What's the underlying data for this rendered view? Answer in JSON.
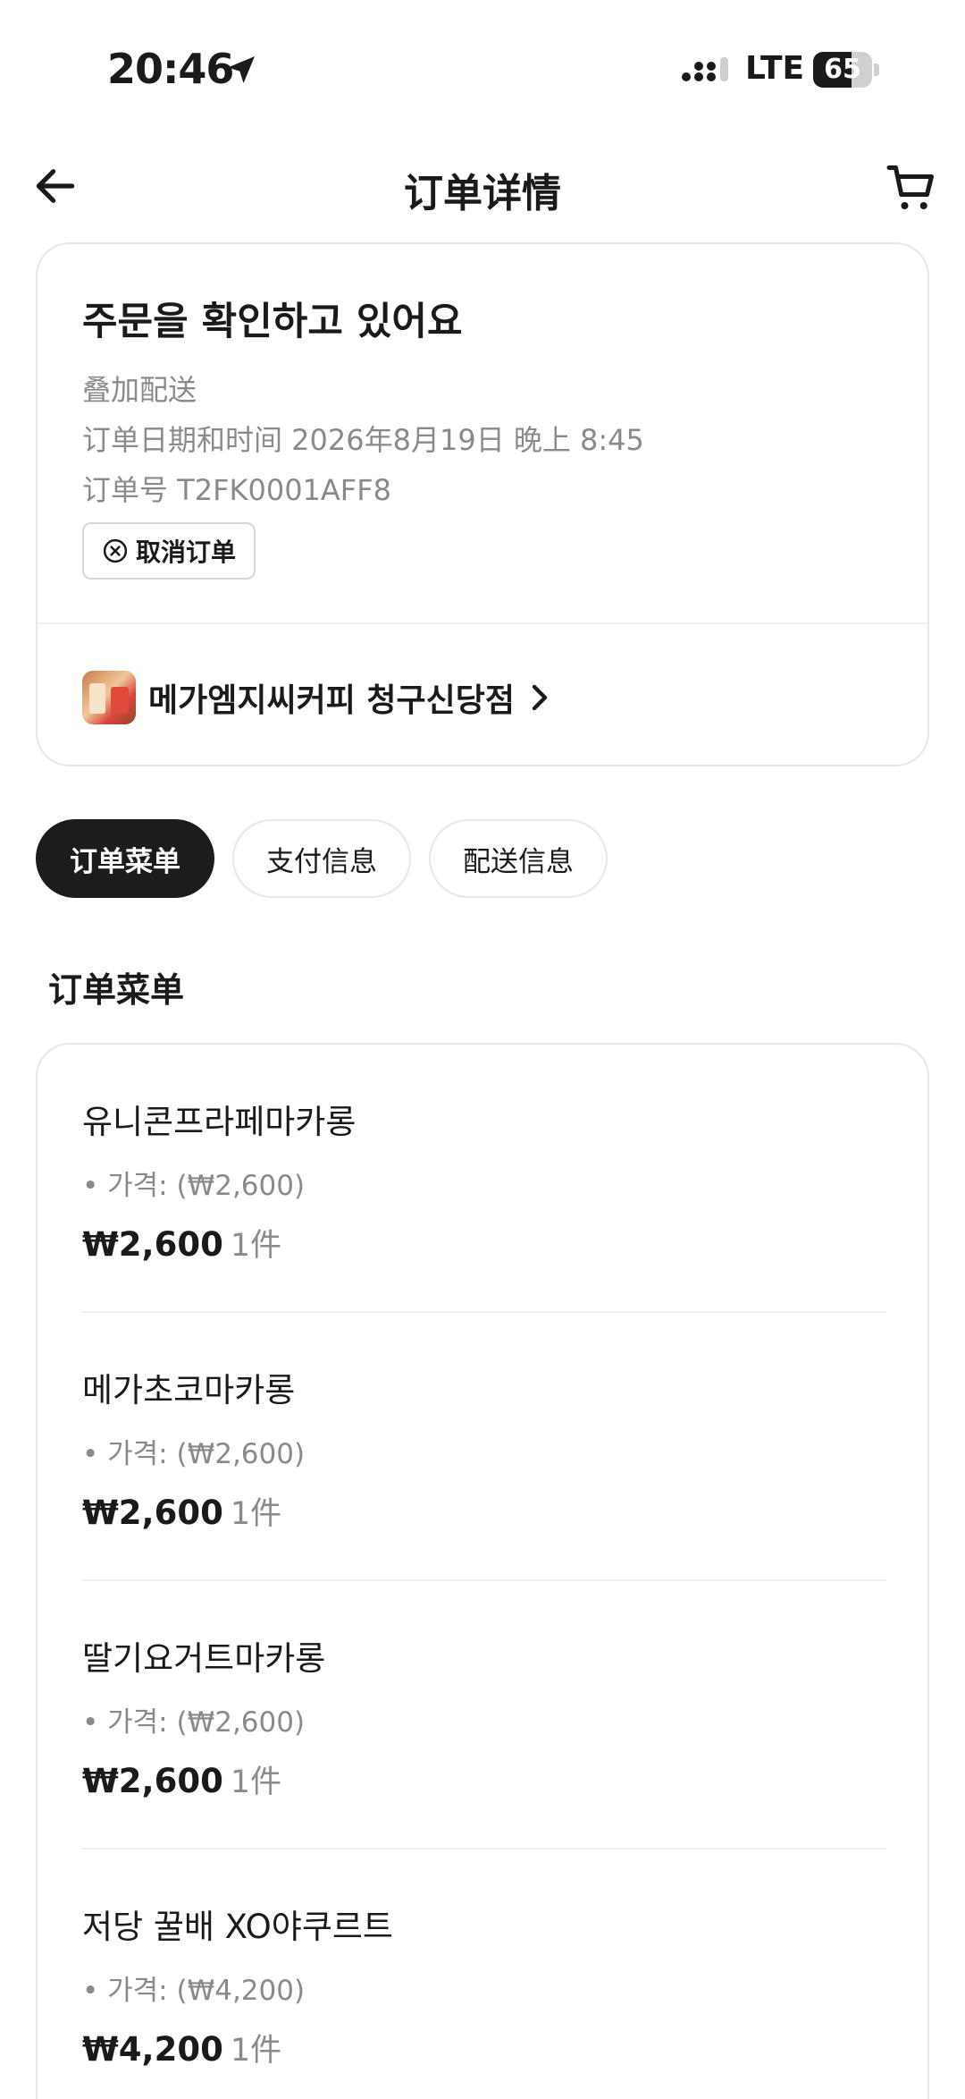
{
  "status_bar": {
    "time": "20:46",
    "network": "LTE",
    "battery": "65",
    "battery_level": 0.65
  },
  "header": {
    "title": "订单详情"
  },
  "order_status": {
    "title": "주문을 확인하고 있어요",
    "delivery_type": "叠加配送",
    "order_datetime": "订单日期和时间 2026年8月19日 晚上 8:45",
    "order_number": "订单号 T2FK0001AFF8",
    "cancel_label": "取消订单",
    "store_name": "메가엠지씨커피 청구신당점"
  },
  "tabs": [
    {
      "label": "订单菜单",
      "active": true
    },
    {
      "label": "支付信息",
      "active": false
    },
    {
      "label": "配送信息",
      "active": false
    }
  ],
  "section_title": "订单菜单",
  "menu_items": [
    {
      "name": "유니콘프라페마카롱",
      "price_option": "• 가격:  (₩2,600)",
      "total": "₩2,600",
      "qty": "1件"
    },
    {
      "name": "메가초코마카롱",
      "price_option": "• 가격:  (₩2,600)",
      "total": "₩2,600",
      "qty": "1件"
    },
    {
      "name": "딸기요거트마카롱",
      "price_option": "• 가격:  (₩2,600)",
      "total": "₩2,600",
      "qty": "1件"
    },
    {
      "name": "저당 꿀배 XO야쿠르트",
      "price_option": "• 가격:  (₩4,200)",
      "total": "₩4,200",
      "qty": "1件"
    }
  ],
  "colors": {
    "active_tab_bg": "#1c1c1e",
    "muted_text": "#8a8a8a",
    "border": "#e6e6e6"
  }
}
